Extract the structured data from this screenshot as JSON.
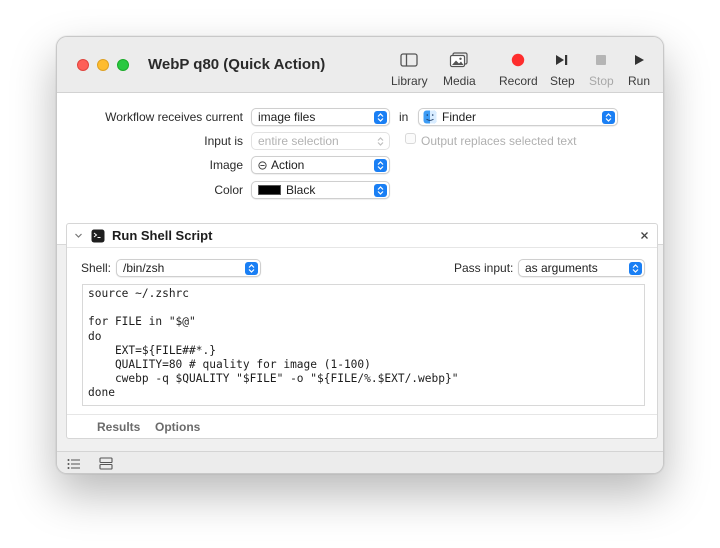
{
  "window": {
    "title": "WebP q80 (Quick Action)"
  },
  "toolbar": {
    "library": "Library",
    "media": "Media",
    "record": "Record",
    "step": "Step",
    "stop": "Stop",
    "run": "Run"
  },
  "workflow": {
    "receives_label": "Workflow receives current",
    "receives_value": "image files",
    "in_label": "in",
    "app_value": "Finder",
    "input_is_label": "Input is",
    "input_is_value": "entire selection",
    "output_replaces_label": "Output replaces selected text",
    "image_label": "Image",
    "image_value": "Action",
    "image_icon": "gear-small-icon",
    "color_label": "Color",
    "color_value": "Black",
    "color_swatch": "#000000"
  },
  "action": {
    "title": "Run Shell Script",
    "shell_label": "Shell:",
    "shell_value": "/bin/zsh",
    "pass_input_label": "Pass input:",
    "pass_input_value": "as arguments",
    "script_lines": [
      "source ~/.zshrc",
      "",
      "for FILE in \"$@\"",
      "do",
      "    EXT=${FILE##*.}",
      "    QUALITY=80 # quality for image (1-100)",
      "    cwebp -q $QUALITY \"$FILE\" -o \"${FILE/%.$EXT/.webp}\"",
      "done"
    ],
    "tabs": [
      "Results",
      "Options"
    ]
  },
  "colors": {
    "accent": "#1a7ff4",
    "record": "#fe2d2d"
  }
}
